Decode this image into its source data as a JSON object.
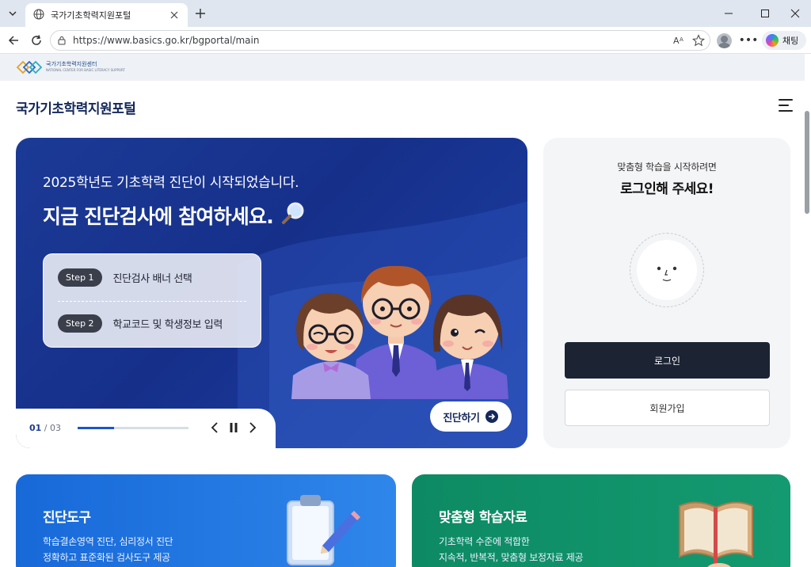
{
  "browser": {
    "tab_title": "국가기초학력지원포털",
    "url": "https://www.basics.go.kr/bgportal/main",
    "copilot_label": "채팅"
  },
  "site": {
    "logo_text_line1": "국가기초학력지원센터",
    "logo_text_line2": "NATIONAL CENTER FOR BASIC LITERACY SUPPORT",
    "title": "국가기초학력지원포털"
  },
  "hero": {
    "subtitle": "2025학년도 기초학력 진단이 시작되었습니다.",
    "headline": "지금 진단검사에 참여하세요.",
    "steps": [
      {
        "badge": "Step 1",
        "text": "진단검사 배너 선택"
      },
      {
        "badge": "Step 2",
        "text": "학교코드 및 학생정보 입력"
      }
    ],
    "pager_current": "01",
    "pager_separator": " / ",
    "pager_total": "03",
    "progress": 0.33,
    "cta_label": "진단하기"
  },
  "login": {
    "hint": "맞춤형 학습을 시작하려면",
    "title": "로그인해 주세요!",
    "login_label": "로그인",
    "signup_label": "회원가입"
  },
  "cards": [
    {
      "title": "진단도구",
      "line1": "학습결손영역 진단, 심리정서 진단",
      "line2": "정확하고 표준화된 검사도구 제공"
    },
    {
      "title": "맞춤형 학습자료",
      "line1": "기초학력 수준에 적합한",
      "line2": "지속적, 반복적, 맞춤형 보정자료 제공"
    }
  ],
  "colors": {
    "hero_bg": "#1b3a96",
    "login_button": "#1c2333",
    "card_blue": "#1769d8",
    "card_green": "#0d8a63"
  }
}
